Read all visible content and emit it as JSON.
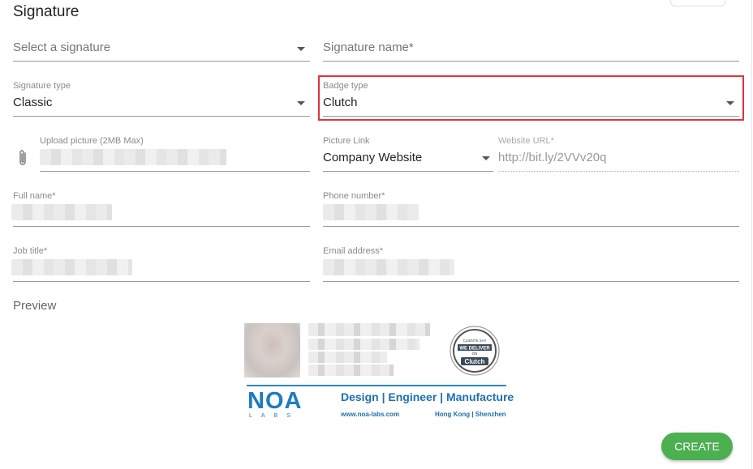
{
  "section_title": "Signature",
  "select_signature": {
    "placeholder": "Select a signature"
  },
  "signature_name": {
    "placeholder": "Signature name*"
  },
  "signature_type": {
    "label": "Signature type",
    "value": "Classic"
  },
  "badge_type": {
    "label": "Badge type",
    "value": "Clutch"
  },
  "upload_picture": {
    "label": "Upload picture (2MB Max)"
  },
  "picture_link": {
    "label": "Picture Link",
    "value": "Company Website"
  },
  "website_url": {
    "label": "Website URL*",
    "value": "http://bit.ly/2VVv20q"
  },
  "full_name": {
    "label": "Full name*"
  },
  "phone_number": {
    "label": "Phone number*"
  },
  "job_title": {
    "label": "Job title*"
  },
  "email_address": {
    "label": "Email address*"
  },
  "preview": {
    "label": "Preview",
    "badge": {
      "line1": "CLIENTS SAY",
      "line2": "WE DELIVER",
      "line3": "ON",
      "brand": "Clutch"
    },
    "logo": {
      "name": "NOA",
      "sub": "LABS"
    },
    "tagline": "Design | Engineer | Manufacture",
    "website": "www.noa-labs.com",
    "cities": "Hong Kong | Shenzhen"
  },
  "create_button": "CREATE",
  "colors": {
    "highlight": "#e0343a",
    "brand_blue": "#1e7bc6",
    "create_green": "#4caf50"
  }
}
